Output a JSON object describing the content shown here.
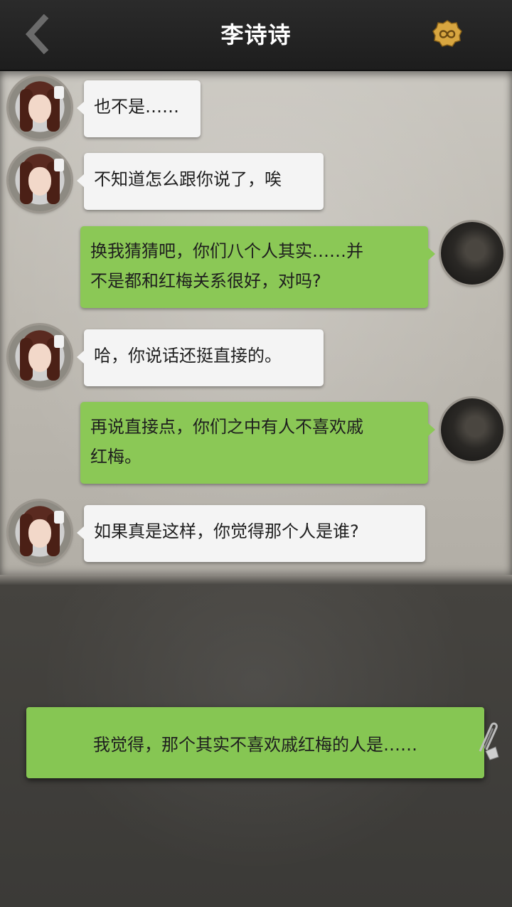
{
  "header": {
    "title": "李诗诗"
  },
  "messages": [
    {
      "side": "left",
      "text": "也不是……"
    },
    {
      "side": "left",
      "text": "不知道怎么跟你说了，唉"
    },
    {
      "side": "right",
      "line1": "换我猜猜吧，你们八个人其实……并",
      "line2": "不是都和红梅关系很好，对吗?"
    },
    {
      "side": "left",
      "text": "哈，你说话还挺直接的。"
    },
    {
      "side": "right",
      "line1": "再说直接点，你们之中有人不喜欢戚",
      "line2": "红梅。"
    },
    {
      "side": "left",
      "text": "如果真是这样，你觉得那个人是谁?"
    }
  ],
  "reply_option": {
    "text": "我觉得，那个其实不喜欢戚红梅的人是……"
  },
  "icons": {
    "back": "chevron-left-icon",
    "coin": "infinity-coin-icon",
    "clip": "paperclip-icon"
  },
  "colors": {
    "header_bg": "#1d1d1d",
    "chat_bg": "#c4c0b8",
    "left_bubble": "#f4f4f4",
    "right_bubble": "#8bc856",
    "bottom_bg": "#3f3e3b"
  }
}
